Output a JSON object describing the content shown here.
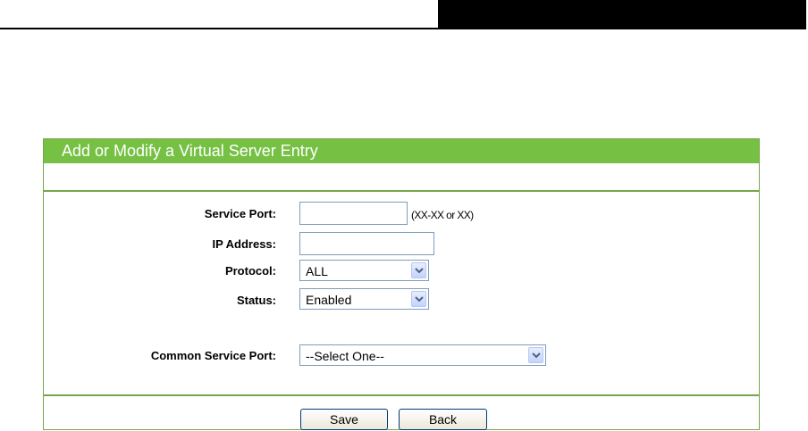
{
  "panel": {
    "title": "Add or Modify a Virtual Server Entry"
  },
  "form": {
    "service_port_label": "Service Port:",
    "service_port_value": "",
    "service_port_hint": "(XX-XX or XX)",
    "ip_address_label": "IP Address:",
    "ip_address_value": "",
    "protocol_label": "Protocol:",
    "protocol_value": "ALL",
    "status_label": "Status:",
    "status_value": "Enabled",
    "common_service_port_label": "Common Service Port:",
    "common_service_port_value": "--Select One--"
  },
  "buttons": {
    "save_label": "Save",
    "back_label": "Back"
  },
  "icons": {
    "dropdown": "chevron-down-icon"
  },
  "colors": {
    "header_green": "#76c044",
    "border_green": "#78a64b"
  }
}
